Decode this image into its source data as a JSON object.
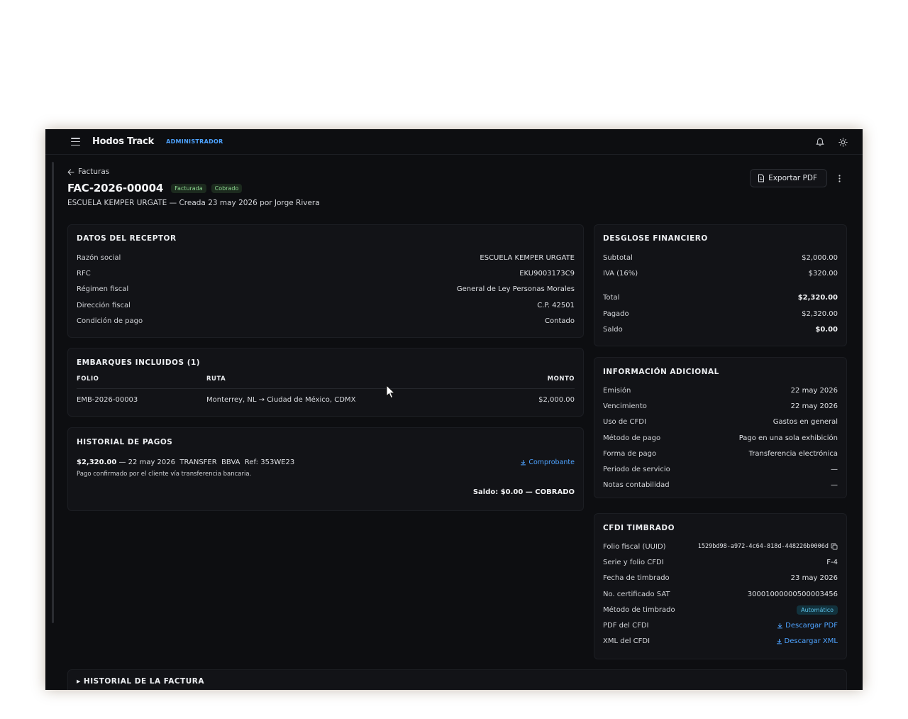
{
  "app": {
    "name": "Hodos Track",
    "role": "ADMINISTRADOR"
  },
  "icons": {
    "menu": "menu-icon",
    "bell": "bell-icon",
    "theme": "sun-icon",
    "back": "arrow-left-icon",
    "pdf": "file-icon",
    "more": "kebab-icon",
    "download": "download-icon",
    "copy": "copy-icon"
  },
  "header": {
    "back_label": "Facturas",
    "invoice_id": "FAC-2026-00004",
    "badge_invoiced": "Facturada",
    "badge_paid": "Cobrado",
    "subtitle": "ESCUELA KEMPER URGATE — Creada 23 may 2026 por Jorge Rivera",
    "export_label": "Exportar PDF"
  },
  "receptor": {
    "title": "DATOS DEL RECEPTOR",
    "rows": [
      {
        "label": "Razón social",
        "value": "ESCUELA KEMPER URGATE"
      },
      {
        "label": "RFC",
        "value": "EKU9003173C9"
      },
      {
        "label": "Régimen fiscal",
        "value": "General de Ley Personas Morales"
      },
      {
        "label": "Dirección fiscal",
        "value": "C.P. 42501"
      },
      {
        "label": "Condición de pago",
        "value": "Contado"
      }
    ]
  },
  "embarques": {
    "title": "EMBARQUES INCLUIDOS (1)",
    "columns": [
      "FOLIO",
      "RUTA",
      "MONTO"
    ],
    "rows": [
      {
        "folio": "EMB-2026-00003",
        "ruta": "Monterrey, NL → Ciudad de México, CDMX",
        "monto": "$2,000.00"
      }
    ]
  },
  "pagos": {
    "title": "HISTORIAL DE PAGOS",
    "amount": "$2,320.00",
    "details": "— 22 may 2026  TRANSFER  BBVA  Ref: 353WE23",
    "note": "Pago confirmado por el cliente vía transferencia bancaria.",
    "receipt_label": "Comprobante",
    "balance": "Saldo: $0.00 — COBRADO"
  },
  "desglose": {
    "title": "DESGLOSE FINANCIERO",
    "subtotal_label": "Subtotal",
    "subtotal": "$2,000.00",
    "iva_label": "IVA (16%)",
    "iva": "$320.00",
    "total_label": "Total",
    "total": "$2,320.00",
    "pagado_label": "Pagado",
    "pagado": "$2,320.00",
    "saldo_label": "Saldo",
    "saldo": "$0.00"
  },
  "adicional": {
    "title": "INFORMACIÓN ADICIONAL",
    "rows": [
      {
        "label": "Emisión",
        "value": "22 may 2026"
      },
      {
        "label": "Vencimiento",
        "value": "22 may 2026"
      },
      {
        "label": "Uso de CFDI",
        "value": "Gastos en general"
      },
      {
        "label": "Método de pago",
        "value": "Pago en una sola exhibición"
      },
      {
        "label": "Forma de pago",
        "value": "Transferencia electrónica"
      },
      {
        "label": "Periodo de servicio",
        "value": "—"
      },
      {
        "label": "Notas contabilidad",
        "value": "—"
      }
    ]
  },
  "cfdi": {
    "title": "CFDI TIMBRADO",
    "uuid_label": "Folio fiscal (UUID)",
    "uuid": "1529bd98-a972-4c64-818d-448226b0006d",
    "serie_label": "Serie y folio CFDI",
    "serie": "F-4",
    "fecha_label": "Fecha de timbrado",
    "fecha": "23 may 2026",
    "cert_label": "No. certificado SAT",
    "cert": "30001000000500003456",
    "metodo_label": "Método de timbrado",
    "metodo": "Automático",
    "pdf_label": "PDF del CFDI",
    "pdf_link": "Descargar PDF",
    "xml_label": "XML del CFDI",
    "xml_link": "Descargar XML"
  },
  "history": {
    "title": "▸ HISTORIAL DE LA FACTURA"
  }
}
